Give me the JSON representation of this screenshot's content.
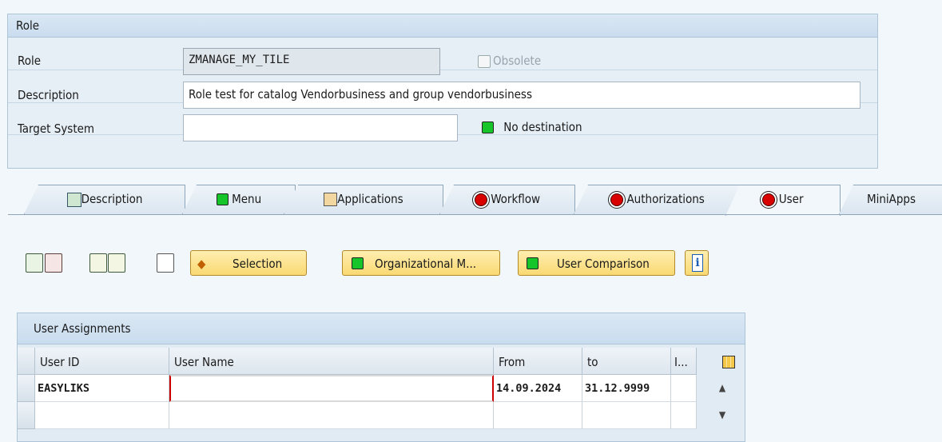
{
  "role_group": {
    "title": "Role",
    "role_label": "Role",
    "role_value": "ZMANAGE_MY_TILE",
    "obsolete_label": "Obsolete",
    "description_label": "Description",
    "description_value": "Role test for catalog Vendorbusiness and group vendorbusiness",
    "target_system_label": "Target System",
    "target_system_value": "",
    "destination_status": "No destination"
  },
  "tabs": [
    {
      "label": "Description"
    },
    {
      "label": "Menu"
    },
    {
      "label": "Applications"
    },
    {
      "label": "Workflow"
    },
    {
      "label": "Authorizations"
    },
    {
      "label": "User"
    },
    {
      "label": "MiniApps"
    }
  ],
  "toolbar": {
    "selection_label": "Selection",
    "org_mgmt_label": "Organizational M...",
    "user_comparison_label": "User Comparison",
    "info_icon": "i"
  },
  "user_assignments": {
    "title": "User Assignments",
    "columns": [
      "User ID",
      "User Name",
      "From",
      "to",
      "I..."
    ],
    "rows": [
      {
        "user_id": "EASYLIKS",
        "user_name": "",
        "from": "14.09.2024",
        "to": "31.12.9999",
        "i": ""
      },
      {
        "user_id": "",
        "user_name": "",
        "from": "",
        "to": "",
        "i": ""
      }
    ]
  },
  "colors": {
    "status_green": "#16c52a",
    "status_red": "#d90000",
    "button_yellow": "#f9d973"
  }
}
